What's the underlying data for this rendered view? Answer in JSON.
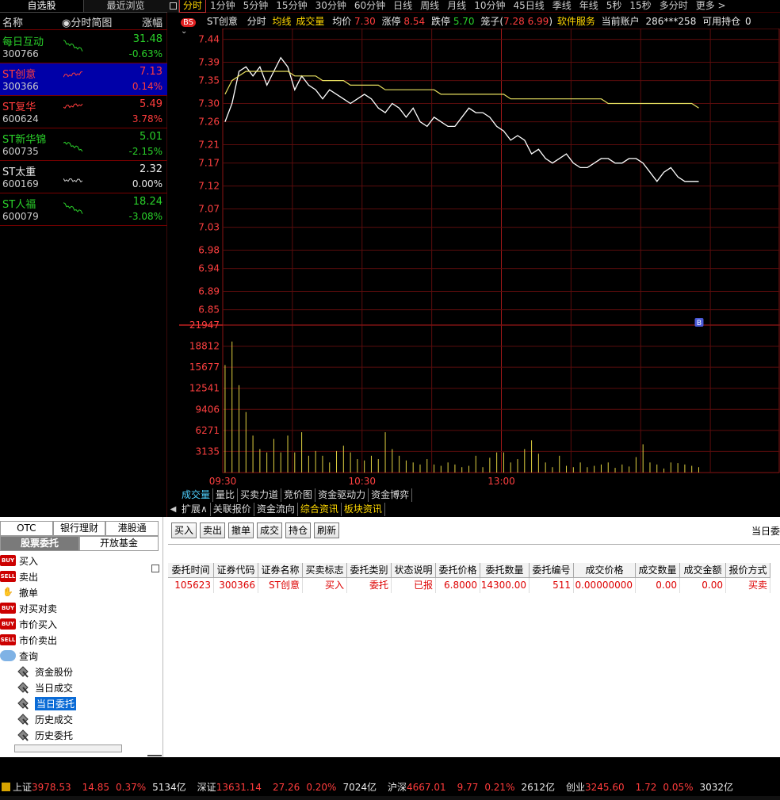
{
  "left_tabs": [
    "自选股",
    "最近浏览"
  ],
  "watchlist_header": {
    "name": "名称",
    "spark": "分时简图",
    "change": "涨幅"
  },
  "watchlist": [
    {
      "name": "每日互动",
      "code": "300766",
      "price": "31.48",
      "pct": "-0.63%",
      "color": "#2ad12a",
      "dir": "down"
    },
    {
      "name": "ST创意",
      "code": "300366",
      "price": "7.13",
      "pct": "0.14%",
      "color": "#ff3c3c",
      "dir": "up"
    },
    {
      "name": "ST复华",
      "code": "600624",
      "price": "5.49",
      "pct": "3.78%",
      "color": "#ff3c3c",
      "dir": "up"
    },
    {
      "name": "ST新华锦",
      "code": "600735",
      "price": "5.01",
      "pct": "-2.15%",
      "color": "#2ad12a",
      "dir": "down"
    },
    {
      "name": "ST太重",
      "code": "600169",
      "price": "2.32",
      "pct": "0.00%",
      "color": "#e8e8e8",
      "dir": "flat"
    },
    {
      "name": "ST人福",
      "code": "600079",
      "price": "18.24",
      "pct": "-3.08%",
      "color": "#2ad12a",
      "dir": "down"
    }
  ],
  "periods": [
    "分时",
    "1分钟",
    "5分钟",
    "15分钟",
    "30分钟",
    "60分钟",
    "日线",
    "周线",
    "月线",
    "10分钟",
    "45日线",
    "季线",
    "年线",
    "5秒",
    "15秒",
    "多分时",
    "更多 >"
  ],
  "info": {
    "badge": "BS",
    "stock": "ST创意",
    "mode": "分时",
    "avg_label": "均线",
    "vol_label": "成交量",
    "avg_price_label": "均价",
    "avg_price": "7.30",
    "limit_up_label": "涨停",
    "limit_up": "8.54",
    "limit_down_label": "跌停",
    "limit_down": "5.70",
    "basket_label": "笼子(",
    "basket": "7.28 6.99",
    "basket_close": ")",
    "sector": "软件服务",
    "account_label": "当前账户",
    "account": "286***258",
    "avail_label": "可用持仓",
    "avail": "0"
  },
  "chart_data": {
    "type": "line",
    "price_axis_ticks": [
      "7.44",
      "7.39",
      "7.35",
      "7.30",
      "7.26",
      "7.21",
      "7.17",
      "7.12",
      "7.07",
      "7.03",
      "6.98",
      "6.94",
      "6.89",
      "6.85"
    ],
    "volume_axis_ticks": [
      "21947",
      "18812",
      "15677",
      "12541",
      "9406",
      "6271",
      "3135"
    ],
    "time_ticks": [
      "09:30",
      "10:30",
      "13:00"
    ],
    "ylim": [
      6.82,
      7.46
    ],
    "volume_ylim": [
      0,
      21947
    ],
    "marker": "B",
    "series": [
      {
        "name": "",
        "color": "#ffffff",
        "values": [
          7.26,
          7.3,
          7.37,
          7.38,
          7.36,
          7.38,
          7.34,
          7.37,
          7.4,
          7.38,
          7.33,
          7.36,
          7.34,
          7.33,
          7.31,
          7.33,
          7.32,
          7.31,
          7.3,
          7.31,
          7.32,
          7.31,
          7.29,
          7.28,
          7.3,
          7.29,
          7.27,
          7.29,
          7.26,
          7.25,
          7.27,
          7.26,
          7.25,
          7.25,
          7.27,
          7.29,
          7.28,
          7.28,
          7.27,
          7.25,
          7.24,
          7.22,
          7.23,
          7.22,
          7.19,
          7.2,
          7.18,
          7.17,
          7.18,
          7.19,
          7.17,
          7.16,
          7.16,
          7.17,
          7.18,
          7.18,
          7.17,
          7.17,
          7.18,
          7.18,
          7.17,
          7.15,
          7.13,
          7.15,
          7.16,
          7.14,
          7.13,
          7.13,
          7.13
        ]
      },
      {
        "name": "",
        "color": "#e8e060",
        "values": [
          7.32,
          7.35,
          7.36,
          7.37,
          7.37,
          7.37,
          7.37,
          7.37,
          7.37,
          7.37,
          7.36,
          7.36,
          7.36,
          7.36,
          7.35,
          7.35,
          7.35,
          7.35,
          7.34,
          7.34,
          7.34,
          7.34,
          7.34,
          7.33,
          7.33,
          7.33,
          7.33,
          7.33,
          7.33,
          7.33,
          7.33,
          7.32,
          7.32,
          7.32,
          7.32,
          7.32,
          7.32,
          7.32,
          7.32,
          7.32,
          7.32,
          7.31,
          7.31,
          7.31,
          7.31,
          7.31,
          7.31,
          7.31,
          7.31,
          7.31,
          7.31,
          7.31,
          7.31,
          7.31,
          7.31,
          7.3,
          7.3,
          7.3,
          7.3,
          7.3,
          7.3,
          7.3,
          7.3,
          7.3,
          7.3,
          7.3,
          7.3,
          7.3,
          7.29
        ]
      }
    ],
    "volumes": [
      16000,
      19500,
      13000,
      9000,
      5500,
      3500,
      3000,
      5000,
      3000,
      5500,
      3000,
      6000,
      2500,
      3200,
      2500,
      1500,
      3200,
      4000,
      3000,
      2000,
      1800,
      2500,
      2000,
      6000,
      3500,
      2500,
      1800,
      1500,
      1200,
      2000,
      1200,
      1000,
      1500,
      1200,
      800,
      1000,
      2500,
      800,
      2200,
      3000,
      3000,
      1500,
      2000,
      3500,
      4800,
      2800,
      1500,
      800,
      2500,
      1000,
      800,
      1500,
      800,
      1000,
      1200,
      1500,
      700,
      1200,
      900,
      2300,
      4200,
      1500,
      1200,
      600,
      1500,
      1400,
      1200,
      1000,
      800
    ]
  },
  "chart_tabs_1": [
    "成交量",
    "量比",
    "买卖力道",
    "竞价图",
    "资金驱动力",
    "资金博弈"
  ],
  "chart_tabs_2": [
    "扩展∧",
    "关联报价",
    "资金流向",
    "综合资讯",
    "板块资讯"
  ],
  "trade_tabs_1": [
    "OTC",
    "银行理财",
    "港股通"
  ],
  "trade_tabs_2": [
    "股票委托",
    "开放基金"
  ],
  "tree": [
    {
      "label": "买入",
      "icon": "buy-icon",
      "tag": "BUY",
      "level": 0
    },
    {
      "label": "卖出",
      "icon": "sell-icon",
      "tag": "SELL",
      "level": 0
    },
    {
      "label": "撤单",
      "icon": "cancel-icon",
      "tag": "",
      "level": 0
    },
    {
      "label": "对买对卖",
      "icon": "buy-icon",
      "tag": "BUY",
      "level": 0
    },
    {
      "label": "市价买入",
      "icon": "buy-icon",
      "tag": "BUY",
      "level": 0
    },
    {
      "label": "市价卖出",
      "icon": "sell-icon",
      "tag": "SELL",
      "level": 0
    },
    {
      "label": "查询",
      "icon": "search-icon",
      "tag": "",
      "level": 0
    },
    {
      "label": "资金股份",
      "icon": "folder-icon",
      "tag": "",
      "level": 1
    },
    {
      "label": "当日成交",
      "icon": "folder-icon",
      "tag": "",
      "level": 1
    },
    {
      "label": "当日委托",
      "icon": "folder-icon",
      "tag": "",
      "level": 1,
      "selected": true
    },
    {
      "label": "历史成交",
      "icon": "folder-icon",
      "tag": "",
      "level": 1
    },
    {
      "label": "历史委托",
      "icon": "folder-icon",
      "tag": "",
      "level": 1
    }
  ],
  "action_buttons": [
    "买入",
    "卖出",
    "撤单",
    "成交",
    "持仓",
    "刷新"
  ],
  "panel_title": "当日委",
  "order_columns": [
    "委托时间",
    "证券代码",
    "证券名称",
    "买卖标志",
    "委托类别",
    "状态说明",
    "委托价格",
    "委托数量",
    "委托编号",
    "成交价格",
    "成交数量",
    "成交金额",
    "报价方式"
  ],
  "order_rows": [
    [
      "105623",
      "300366",
      "ST创意",
      "买入",
      "委托",
      "已报",
      "6.8000",
      "14300.00",
      "511",
      "0.00000000",
      "0.00",
      "0.00",
      "买卖"
    ]
  ],
  "status_bar": [
    {
      "name": "上证",
      "index": "3978.53",
      "chg": "14.85",
      "pct": "0.37%",
      "amount": "5134亿"
    },
    {
      "name": "深证",
      "index": "13631.14",
      "chg": "27.26",
      "pct": "0.20%",
      "amount": "7024亿"
    },
    {
      "name": "沪深",
      "index": "4667.01",
      "chg": "9.77",
      "pct": "0.21%",
      "amount": "2612亿"
    },
    {
      "name": "创业",
      "index": "3245.60",
      "chg": "1.72",
      "pct": "0.05%",
      "amount": "3032亿"
    }
  ]
}
